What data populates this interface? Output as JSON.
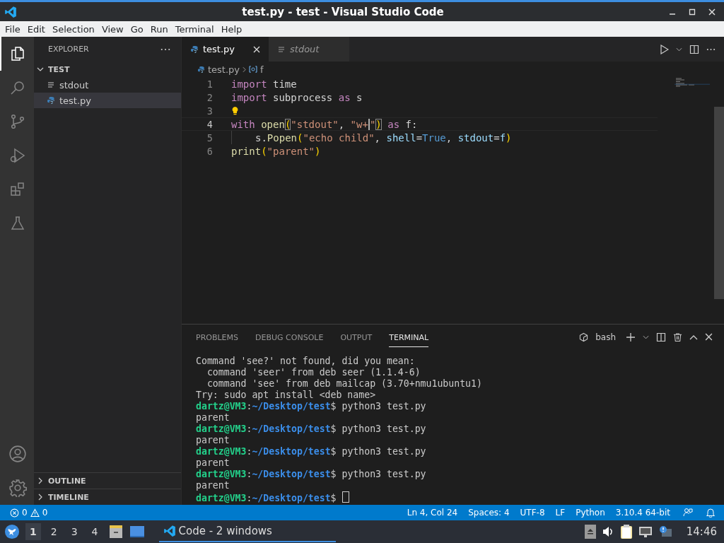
{
  "window": {
    "title": "test.py - test - Visual Studio Code"
  },
  "menu": [
    "File",
    "Edit",
    "Selection",
    "View",
    "Go",
    "Run",
    "Terminal",
    "Help"
  ],
  "activity_bar": [
    {
      "kind": "explorer",
      "selected": true
    },
    {
      "kind": "search",
      "selected": false
    },
    {
      "kind": "source-control",
      "selected": false
    },
    {
      "kind": "run-debug",
      "selected": false
    },
    {
      "kind": "extensions",
      "selected": false
    },
    {
      "kind": "testing",
      "selected": false
    }
  ],
  "activity_bar_bottom": [
    {
      "kind": "account"
    },
    {
      "kind": "settings"
    }
  ],
  "sidebar": {
    "title": "EXPLORER",
    "folder": {
      "name": "TEST",
      "expanded": true,
      "children": [
        {
          "name": "stdout",
          "kind": "text",
          "selected": false
        },
        {
          "name": "test.py",
          "kind": "python",
          "selected": true
        }
      ]
    },
    "sections": [
      {
        "name": "OUTLINE",
        "expanded": false
      },
      {
        "name": "TIMELINE",
        "expanded": false
      }
    ]
  },
  "tabs": [
    {
      "label": "test.py",
      "kind": "python",
      "selected": true,
      "preview": false
    },
    {
      "label": "stdout",
      "kind": "text",
      "selected": false,
      "preview": true
    }
  ],
  "breadcrumb": {
    "file": "test.py",
    "symbol": "f"
  },
  "editor": {
    "lines": [
      {
        "number": "1",
        "current": false,
        "lightbulb": false,
        "indent_guide": false,
        "tokens": [
          {
            "text": "import",
            "kind": "kw"
          },
          {
            "text": " time",
            "kind": "plain"
          }
        ]
      },
      {
        "number": "2",
        "current": false,
        "lightbulb": false,
        "indent_guide": false,
        "tokens": [
          {
            "text": "import",
            "kind": "kw"
          },
          {
            "text": " subprocess ",
            "kind": "plain"
          },
          {
            "text": "as",
            "kind": "kw"
          },
          {
            "text": " s",
            "kind": "plain"
          }
        ]
      },
      {
        "number": "3",
        "current": false,
        "lightbulb": true,
        "indent_guide": false
      },
      {
        "number": "4",
        "current": true,
        "lightbulb": false,
        "indent_guide": false,
        "tokens": [
          {
            "text": "with ",
            "kind": "kw"
          },
          {
            "text": "open",
            "kind": "fn"
          },
          {
            "text": "(",
            "kind": "match"
          },
          {
            "text": "\"stdout\"",
            "kind": "str"
          },
          {
            "text": ", ",
            "kind": "plain"
          },
          {
            "text": "\"w+",
            "kind": "str-caret"
          },
          {
            "text": "\"",
            "kind": "str"
          },
          {
            "text": ")",
            "kind": "match"
          },
          {
            "text": " as",
            "kind": "kw"
          },
          {
            "text": " f:",
            "kind": "plain"
          }
        ]
      },
      {
        "number": "5",
        "current": false,
        "lightbulb": false,
        "indent_guide": true,
        "tokens": [
          {
            "text": "s.",
            "kind": "plain"
          },
          {
            "text": "Popen",
            "kind": "fn"
          },
          {
            "text": "(",
            "kind": "paren"
          },
          {
            "text": "\"echo child\"",
            "kind": "str"
          },
          {
            "text": ", ",
            "kind": "plain"
          },
          {
            "text": "shell",
            "kind": "param"
          },
          {
            "text": "=",
            "kind": "plain"
          },
          {
            "text": "True",
            "kind": "const"
          },
          {
            "text": ", ",
            "kind": "plain"
          },
          {
            "text": "stdout",
            "kind": "param"
          },
          {
            "text": "=",
            "kind": "plain"
          },
          {
            "text": "f",
            "kind": "param"
          },
          {
            "text": ")",
            "kind": "paren"
          }
        ]
      },
      {
        "number": "6",
        "current": false,
        "lightbulb": false,
        "indent_guide": false,
        "tokens": [
          {
            "text": "print",
            "kind": "fn"
          },
          {
            "text": "(",
            "kind": "paren"
          },
          {
            "text": "\"parent\"",
            "kind": "str"
          },
          {
            "text": ")",
            "kind": "paren"
          }
        ]
      }
    ]
  },
  "panel": {
    "tabs": [
      {
        "label": "PROBLEMS",
        "selected": false
      },
      {
        "label": "DEBUG CONSOLE",
        "selected": false
      },
      {
        "label": "OUTPUT",
        "selected": false
      },
      {
        "label": "TERMINAL",
        "selected": true
      }
    ],
    "shell": "bash",
    "terminal": [
      {
        "kind": "output",
        "text": "Command 'see?' not found, did you mean:"
      },
      {
        "kind": "output",
        "text": "  command 'seer' from deb seer (1.1.4-6)"
      },
      {
        "kind": "output",
        "text": "  command 'see' from deb mailcap (3.70+nmu1ubuntu1)"
      },
      {
        "kind": "output",
        "text": "Try: sudo apt install <deb name>"
      },
      {
        "kind": "prompt",
        "user": "dartz@VM3",
        "sep": ":",
        "path": "~/Desktop/test",
        "symbol": "$",
        "command": "python3 test.py",
        "cursor": false
      },
      {
        "kind": "output",
        "text": "parent"
      },
      {
        "kind": "prompt",
        "user": "dartz@VM3",
        "sep": ":",
        "path": "~/Desktop/test",
        "symbol": "$",
        "command": "python3 test.py",
        "cursor": false
      },
      {
        "kind": "output",
        "text": "parent"
      },
      {
        "kind": "prompt",
        "user": "dartz@VM3",
        "sep": ":",
        "path": "~/Desktop/test",
        "symbol": "$",
        "command": "python3 test.py",
        "cursor": false
      },
      {
        "kind": "output",
        "text": "parent"
      },
      {
        "kind": "prompt",
        "user": "dartz@VM3",
        "sep": ":",
        "path": "~/Desktop/test",
        "symbol": "$",
        "command": "python3 test.py",
        "cursor": false
      },
      {
        "kind": "output",
        "text": "parent"
      },
      {
        "kind": "prompt",
        "user": "dartz@VM3",
        "sep": ":",
        "path": "~/Desktop/test",
        "symbol": "$",
        "cursor": true
      }
    ]
  },
  "status_bar": {
    "errors": "0",
    "warnings": "0",
    "items": [
      "Ln 4, Col 24",
      "Spaces: 4",
      "UTF-8",
      "LF",
      "Python",
      "3.10.4 64-bit"
    ]
  },
  "taskbar": {
    "workspaces": [
      {
        "label": "1",
        "selected": true
      },
      {
        "label": "2",
        "selected": false
      },
      {
        "label": "3",
        "selected": false
      },
      {
        "label": "4",
        "selected": false
      }
    ],
    "task": {
      "label": "Code - 2 windows",
      "selected": true
    },
    "clock": "14:46"
  }
}
